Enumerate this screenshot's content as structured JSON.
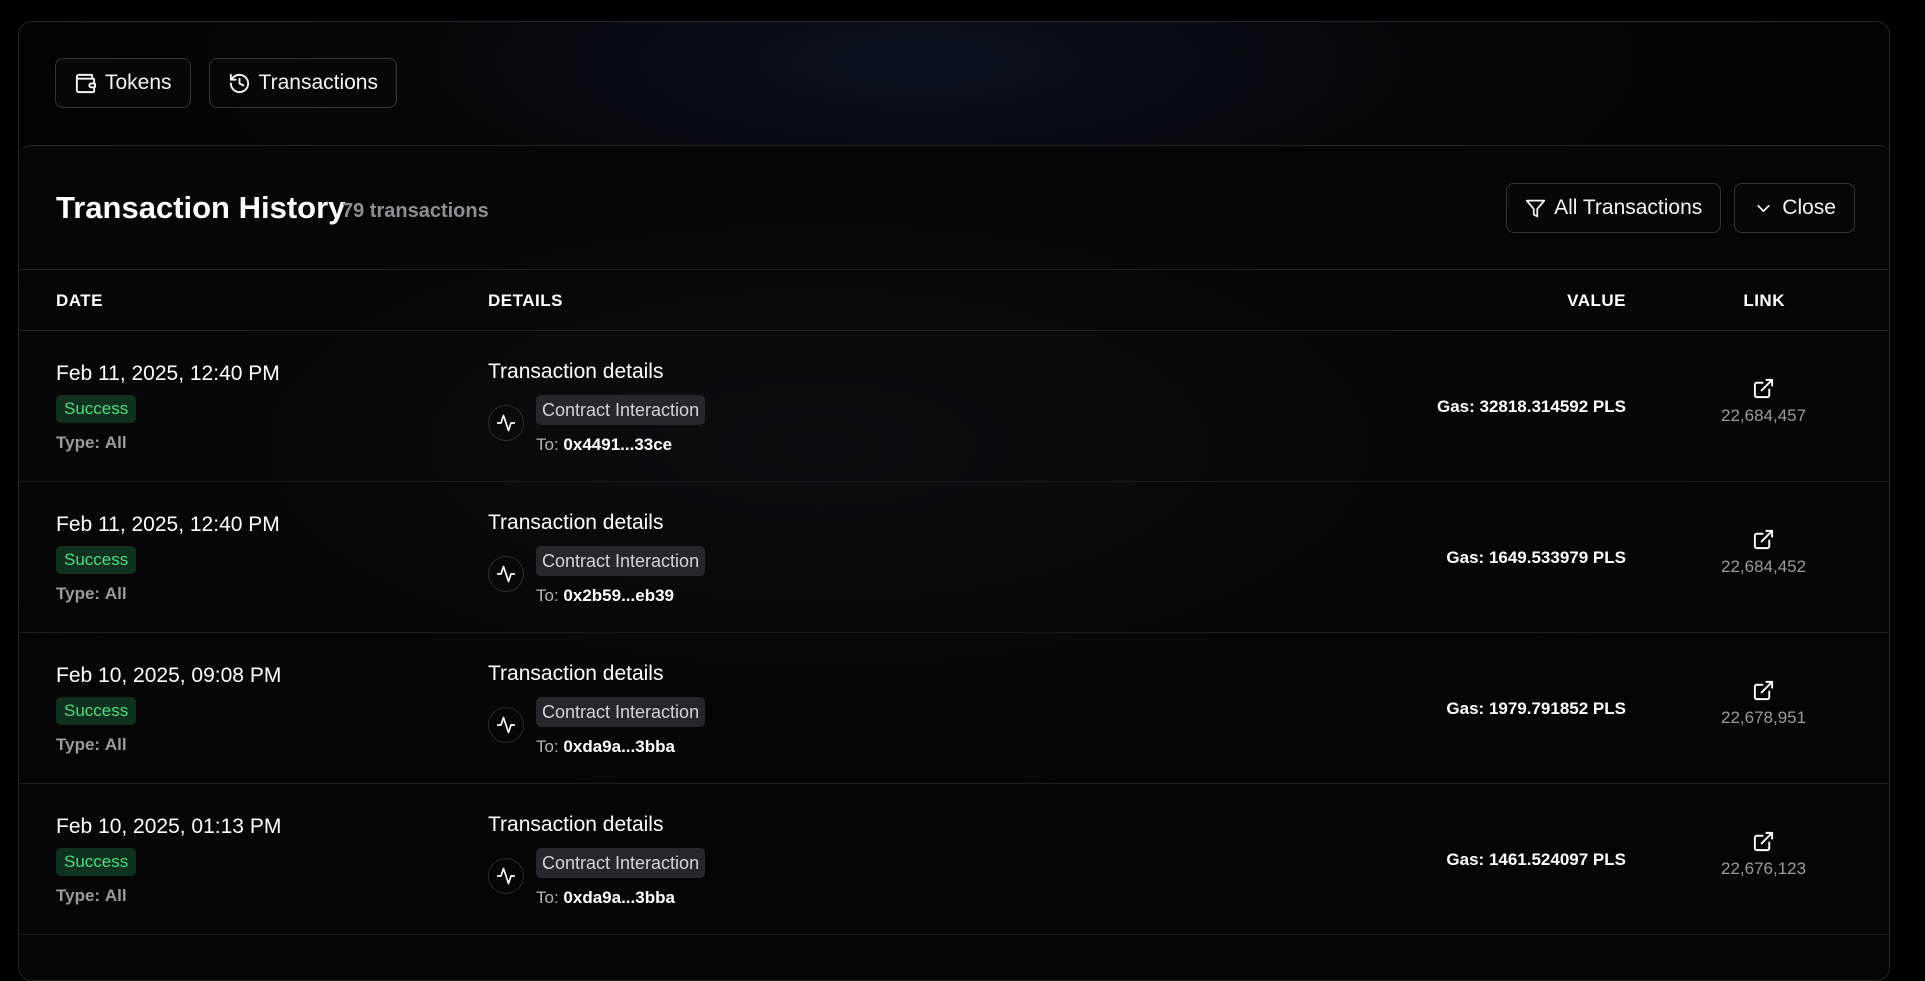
{
  "tabs": [
    {
      "label": "Tokens",
      "icon": "wallet-icon"
    },
    {
      "label": "Transactions",
      "icon": "history-icon"
    }
  ],
  "history": {
    "title": "Transaction History",
    "count": "79 transactions",
    "filter_label": "All Transactions",
    "close_label": "Close"
  },
  "columns": {
    "date": "DATE",
    "details": "DETAILS",
    "value": "VALUE",
    "link": "LINK"
  },
  "rows": [
    {
      "date": "Feb 11, 2025, 12:40 PM",
      "status": "Success",
      "type_label": "Type:",
      "type": "All",
      "details_title": "Transaction details",
      "tag": "Contract Interaction",
      "to_label": "To:",
      "to": "0x4491...33ce",
      "gas": "Gas: 32818.314592 PLS",
      "block": "22,684,457"
    },
    {
      "date": "Feb 11, 2025, 12:40 PM",
      "status": "Success",
      "type_label": "Type:",
      "type": "All",
      "details_title": "Transaction details",
      "tag": "Contract Interaction",
      "to_label": "To:",
      "to": "0x2b59...eb39",
      "gas": "Gas: 1649.533979 PLS",
      "block": "22,684,452"
    },
    {
      "date": "Feb 10, 2025, 09:08 PM",
      "status": "Success",
      "type_label": "Type:",
      "type": "All",
      "details_title": "Transaction details",
      "tag": "Contract Interaction",
      "to_label": "To:",
      "to": "0xda9a...3bba",
      "gas": "Gas: 1979.791852 PLS",
      "block": "22,678,951"
    },
    {
      "date": "Feb 10, 2025, 01:13 PM",
      "status": "Success",
      "type_label": "Type:",
      "type": "All",
      "details_title": "Transaction details",
      "tag": "Contract Interaction",
      "to_label": "To:",
      "to": "0xda9a...3bba",
      "gas": "Gas: 1461.524097 PLS",
      "block": "22,676,123"
    }
  ],
  "colors": {
    "success": "#4ade80",
    "success_bg": "#11311f",
    "background": "#050506"
  }
}
